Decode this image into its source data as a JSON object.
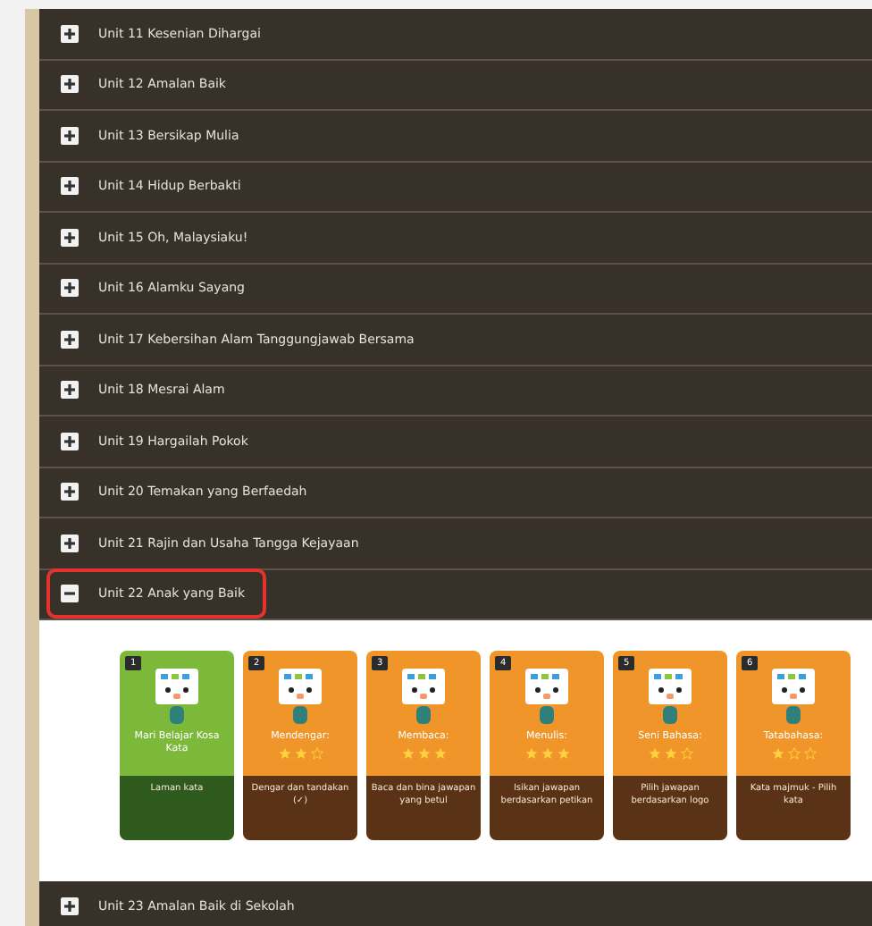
{
  "units": [
    {
      "title": "Unit 11 Kesenian Dihargai",
      "expanded": false,
      "highlighted": false
    },
    {
      "title": "Unit 12 Amalan Baik",
      "expanded": false,
      "highlighted": false
    },
    {
      "title": "Unit 13 Bersikap Mulia",
      "expanded": false,
      "highlighted": false
    },
    {
      "title": "Unit 14 Hidup Berbakti",
      "expanded": false,
      "highlighted": false
    },
    {
      "title": "Unit 15 Oh, Malaysiaku!",
      "expanded": false,
      "highlighted": false
    },
    {
      "title": "Unit 16 Alamku Sayang",
      "expanded": false,
      "highlighted": false
    },
    {
      "title": "Unit 17 Kebersihan Alam Tanggungjawab Bersama",
      "expanded": false,
      "highlighted": false
    },
    {
      "title": "Unit 18 Mesrai Alam",
      "expanded": false,
      "highlighted": false
    },
    {
      "title": "Unit 19 Hargailah Pokok",
      "expanded": false,
      "highlighted": false
    },
    {
      "title": "Unit 20 Temakan yang Berfaedah",
      "expanded": false,
      "highlighted": false
    },
    {
      "title": "Unit 21 Rajin dan Usaha Tangga Kejayaan",
      "expanded": false,
      "highlighted": false
    },
    {
      "title": "Unit 22 Anak yang Baik",
      "expanded": true,
      "highlighted": true,
      "cards": [
        {
          "kind": "intro",
          "number": "1",
          "title": "Mari Belajar Kosa Kata",
          "description": "Laman kata"
        },
        {
          "kind": "exercise",
          "number": "2",
          "title": "Mendengar:",
          "stars": 2,
          "description": "Dengar dan tandakan (✓)"
        },
        {
          "kind": "exercise",
          "number": "3",
          "title": "Membaca:",
          "stars": 3,
          "description": "Baca dan bina jawapan yang betul"
        },
        {
          "kind": "exercise",
          "number": "4",
          "title": "Menulis:",
          "stars": 3,
          "description": "Isikan jawapan berdasarkan petikan"
        },
        {
          "kind": "exercise",
          "number": "5",
          "title": "Seni Bahasa:",
          "stars": 2,
          "description": "Pilih jawapan berdasarkan logo"
        },
        {
          "kind": "exercise",
          "number": "6",
          "title": "Tatabahasa:",
          "stars": 1,
          "description": "Kata majmuk - Pilih kata"
        }
      ]
    },
    {
      "title": "Unit 23 Amalan Baik di Sekolah",
      "expanded": false,
      "highlighted": false
    }
  ]
}
